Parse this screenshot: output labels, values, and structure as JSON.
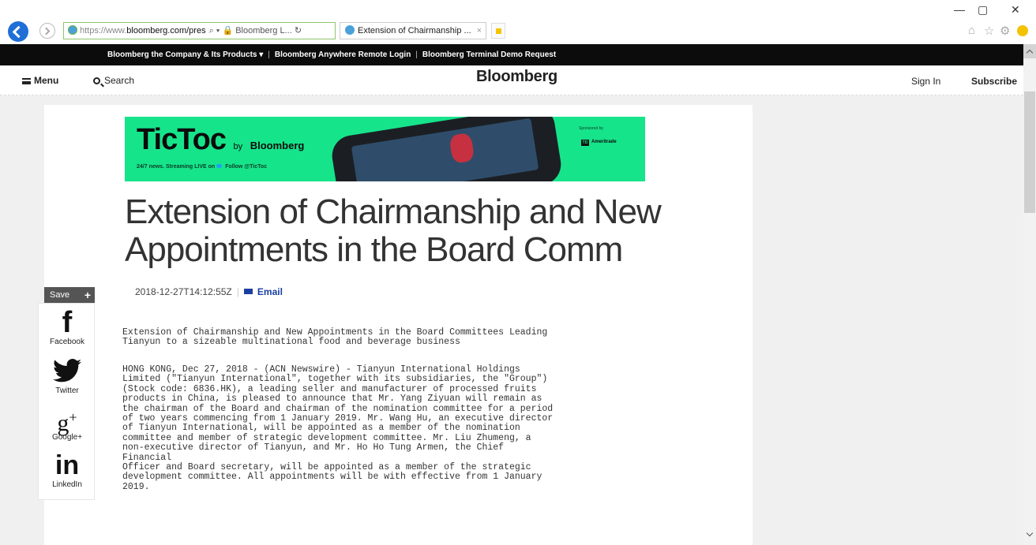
{
  "browser": {
    "address_url_gray": "https://www.",
    "address_url_dark": "bloomberg.com/pres",
    "address_controls": "⌕ ▾  🔒 Bloomberg L... ↻",
    "tab_title": "Extension of Chairmanship ...",
    "tab_close": "×",
    "minimize": "—",
    "restore": "▢",
    "close": "✕",
    "home_icon": "⌂",
    "favorites_icon": "☆",
    "settings_icon": "⚙"
  },
  "company_bar": {
    "item1": "Bloomberg the Company & Its Products ▾",
    "sep": "|",
    "item2": "Bloomberg Anywhere Remote Login",
    "item3": "Bloomberg Terminal Demo Request"
  },
  "header": {
    "menu_label": "Menu",
    "search_label": "Search",
    "logo": "Bloomberg",
    "signin_label": "Sign In",
    "subscribe_label": "Subscribe"
  },
  "ad": {
    "brand": "TicToc",
    "by": "by",
    "brand_owner": "Bloomberg",
    "tagline_left": "24/7 news. Streaming LIVE on",
    "tagline_right": "Follow @TicToc",
    "sponsored": "Sponsored by",
    "sponsor_box": "TD",
    "sponsor": "Ameritrade"
  },
  "article": {
    "headline": "Extension of Chairmanship and New Appointments in the Board Comm",
    "timestamp": "2018-12-27T14:12:55Z",
    "meta_sep": "|",
    "email_label": "Email",
    "paragraph1": "Extension of Chairmanship and New Appointments in the Board Committees Leading\nTianyun to a sizeable multinational food and beverage business",
    "paragraph2": "HONG KONG, Dec 27, 2018 - (ACN Newswire) - Tianyun International Holdings\nLimited (\"Tianyun International\", together with its subsidiaries, the \"Group\")\n(Stock code: 6836.HK), a leading seller and manufacturer of processed fruits\nproducts in China, is pleased to announce that Mr. Yang Ziyuan will remain as\nthe chairman of the Board and chairman of the nomination committee for a period\nof two years commencing from 1 January 2019. Mr. Wang Hu, an executive director\nof Tianyun International, will be appointed as a member of the nomination\ncommittee and member of strategic development committee. Mr. Liu Zhumeng, a\nnon-executive director of Tianyun, and Mr. Ho Ho Tung Armen, the Chief\nFinancial\nOfficer and Board secretary, will be appointed as a member of the strategic\ndevelopment committee. All appointments will be with effective from 1 January\n2019."
  },
  "share": {
    "save_label": "Save",
    "save_plus": "+",
    "facebook_glyph": "f",
    "facebook_label": "Facebook",
    "twitter_label": "Twitter",
    "googleplus_glyph": "g",
    "googleplus_sup": "+",
    "googleplus_label": "Google+",
    "linkedin_glyph": "in",
    "linkedin_label": "LinkedIn"
  }
}
